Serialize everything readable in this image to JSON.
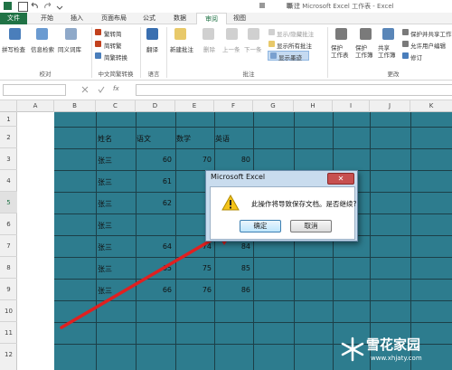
{
  "window": {
    "title": "新建 Microsoft Excel 工作表 - Excel"
  },
  "tabs": [
    {
      "label": "文件"
    },
    {
      "label": "开始"
    },
    {
      "label": "插入"
    },
    {
      "label": "页面布局"
    },
    {
      "label": "公式"
    },
    {
      "label": "数据"
    },
    {
      "label": "审阅"
    },
    {
      "label": "视图"
    }
  ],
  "ribbon": {
    "proofing": {
      "spelling": "拼写检查",
      "research": "信息检索",
      "thesaurus": "同义词库",
      "group": "校对"
    },
    "chinese": {
      "trad_to_simp": "繁转简",
      "simp_to_trad": "简转繁",
      "convert": "简繁转换",
      "group": "中文简繁转换"
    },
    "language": {
      "translate": "翻译",
      "group": "语言"
    },
    "comments": {
      "new_comment": "新建批注",
      "delete": "删除",
      "previous": "上一条",
      "next": "下一条",
      "show_hide": "显示/隐藏批注",
      "show_all": "显示所有批注",
      "show_ink": "显示墨迹",
      "group": "批注"
    },
    "changes": {
      "protect_sheet": "保护\n工作表",
      "protect_workbook": "保护\n工作簿",
      "share_workbook": "共享\n工作簿",
      "protect_share": "保护并共享工作",
      "allow_edit": "允许用户编辑",
      "track": "修订",
      "group": "更改"
    }
  },
  "columns": [
    "A",
    "B",
    "C",
    "D",
    "E",
    "F",
    "G",
    "H",
    "I",
    "J",
    "K"
  ],
  "rows": [
    "1",
    "2",
    "3",
    "4",
    "5",
    "6",
    "7",
    "8",
    "9",
    "10",
    "11",
    "12"
  ],
  "table": {
    "headers": [
      "姓名",
      "语文",
      "数学",
      "英语"
    ],
    "records": [
      {
        "name": "张三",
        "chinese": "60",
        "math": "70",
        "english": "80"
      },
      {
        "name": "张三",
        "chinese": "61",
        "math": "",
        "english": ""
      },
      {
        "name": "张三",
        "chinese": "62",
        "math": "",
        "english": ""
      },
      {
        "name": "张三",
        "chinese": "",
        "math": "",
        "english": ""
      },
      {
        "name": "张三",
        "chinese": "64",
        "math": "74",
        "english": "84"
      },
      {
        "name": "张三",
        "chinese": "65",
        "math": "75",
        "english": "85"
      },
      {
        "name": "张三",
        "chinese": "66",
        "math": "76",
        "english": "86"
      }
    ]
  },
  "dialog": {
    "title": "Microsoft Excel",
    "close": "✕",
    "message": "此操作将导致保存文档。是否继续?",
    "ok": "确定",
    "cancel": "取消"
  },
  "watermark": {
    "brand": "雪花家园",
    "url": "www.xhjaty.com"
  },
  "colors": {
    "excel_green": "#217346",
    "fill": "#2d7c8e",
    "arrow": "#e02020"
  }
}
